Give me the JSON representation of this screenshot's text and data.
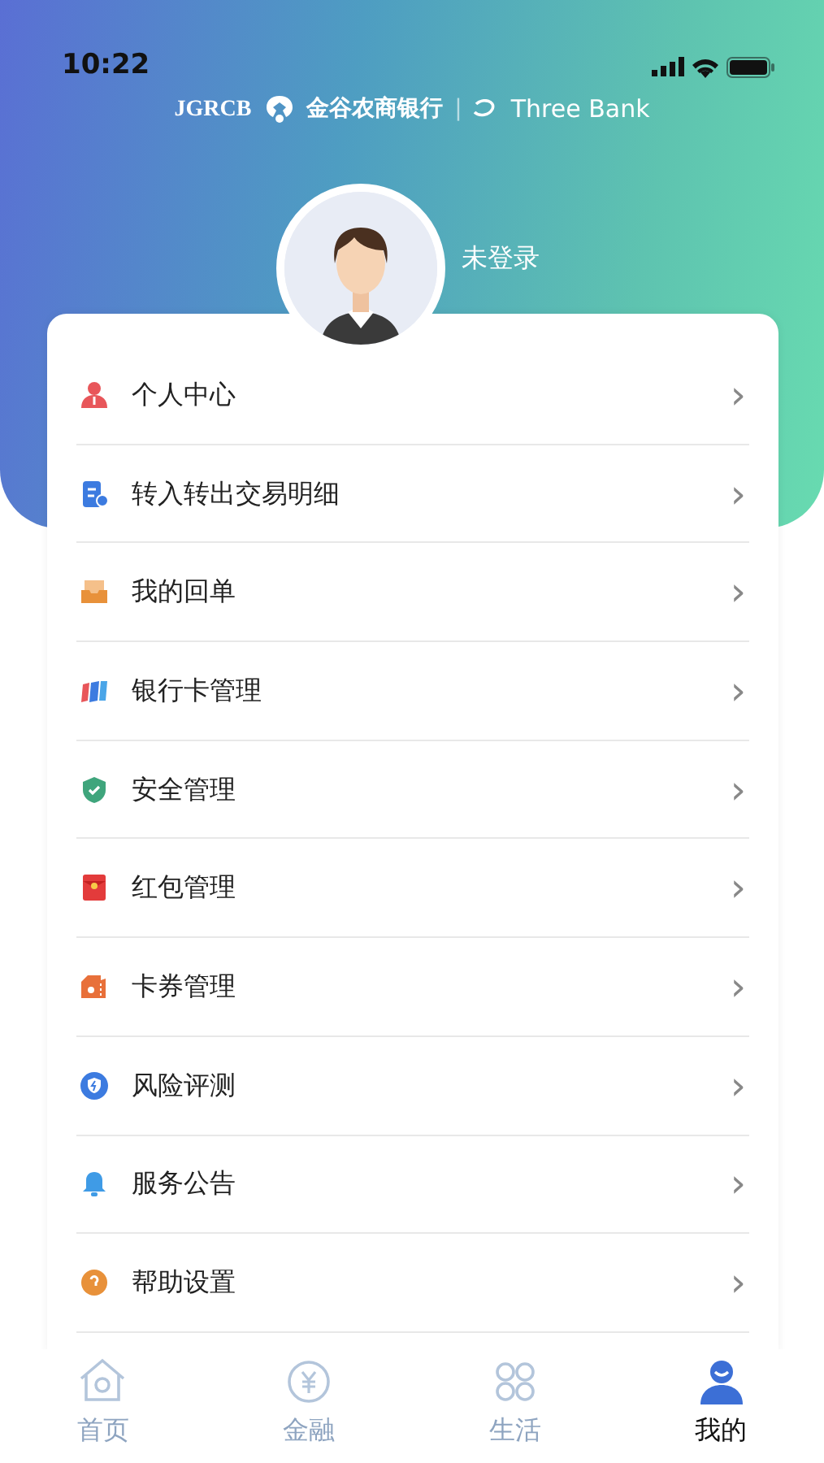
{
  "status_bar": {
    "time": "10:22"
  },
  "brand": {
    "code": "JGRCB",
    "name": "金谷农商银行",
    "separator": "|",
    "partner": "Three Bank"
  },
  "profile": {
    "login_status": "未登录"
  },
  "menu": [
    {
      "label": "个人中心",
      "chevron": "›"
    },
    {
      "label": "转入转出交易明细",
      "chevron": "›"
    },
    {
      "label": "我的回单",
      "chevron": "›"
    },
    {
      "label": "银行卡管理",
      "chevron": "›"
    },
    {
      "label": "安全管理",
      "chevron": "›"
    },
    {
      "label": "红包管理",
      "chevron": "›"
    },
    {
      "label": "卡券管理",
      "chevron": "›"
    },
    {
      "label": "风险评测",
      "chevron": "›"
    },
    {
      "label": "服务公告",
      "chevron": "›"
    },
    {
      "label": "帮助设置",
      "chevron": "›"
    }
  ],
  "tabs": [
    {
      "label": "首页",
      "selected": false
    },
    {
      "label": "金融",
      "selected": false
    },
    {
      "label": "生活",
      "selected": false
    },
    {
      "label": "我的",
      "selected": true
    }
  ]
}
